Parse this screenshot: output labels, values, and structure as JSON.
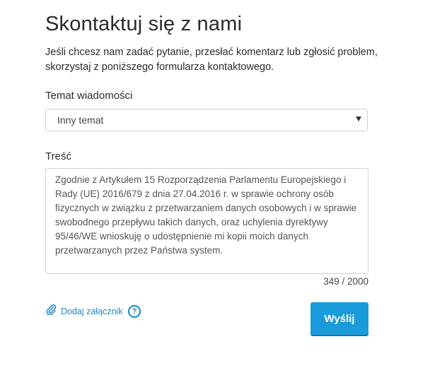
{
  "page": {
    "title": "Skontaktuj się z nami",
    "intro": "Jeśli chcesz nam zadać pytanie, przesłać komentarz lub zgłosić problem, skorzystaj z poniższego formularza kontaktowego."
  },
  "form": {
    "topic_label": "Temat wiadomości",
    "topic_value": "Inny temat",
    "body_label": "Treść",
    "body_value": "Zgodnie z Artykułem 15 Rozporządzenia Parlamentu Europejskiego i Rady (UE) 2016/679 z dnia 27.04.2016 r. w sprawie ochrony osób fizycznych w związku z przetwarzaniem danych osobowych i w sprawie swobodnego przepływu takich danych, oraz uchylenia dyrektywy 95/46/WE wnioskuję o udostępnienie mi kopii moich danych przetwarzanych przez Państwa system.",
    "char_counter": "349 / 2000",
    "attach_label": "Dodaj załącznik",
    "help_symbol": "?",
    "submit_label": "Wyślij"
  },
  "colors": {
    "accent": "#1a9bd9",
    "link": "#1a87c9",
    "border": "#cfd3d7"
  },
  "icons": {
    "attach": "paperclip-icon",
    "help": "question-circle-icon",
    "dropdown": "caret-down-icon"
  }
}
